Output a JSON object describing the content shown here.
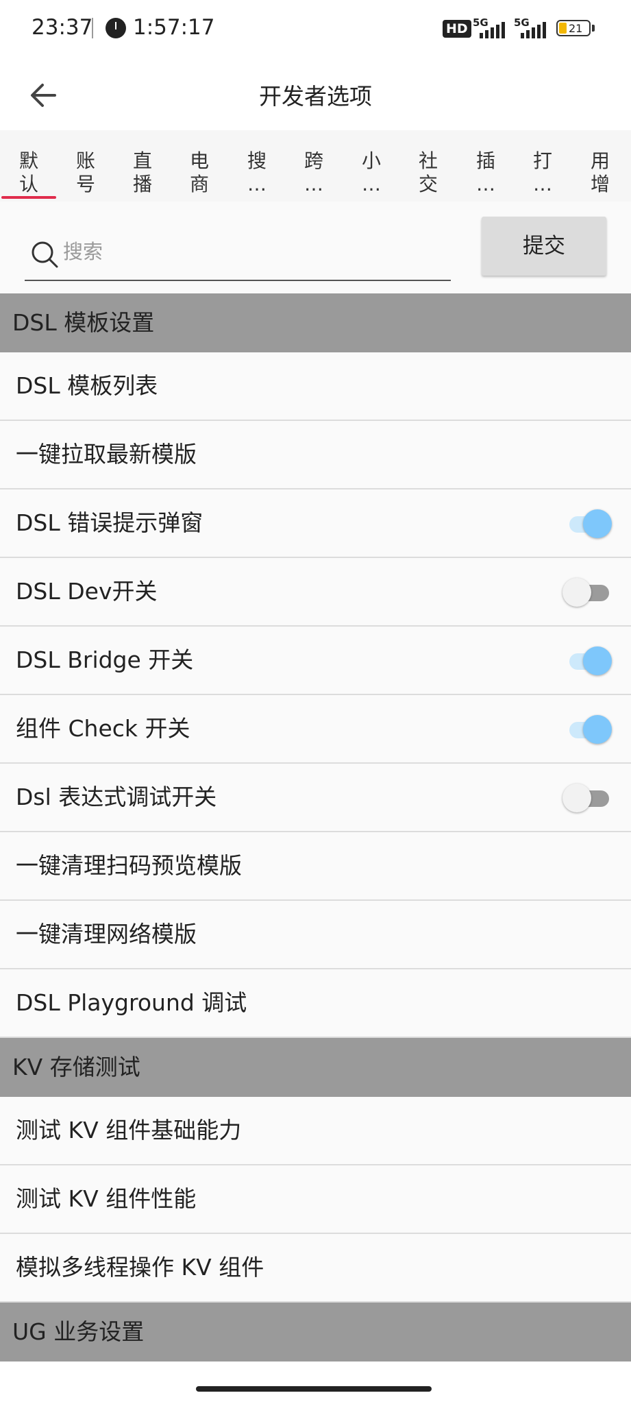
{
  "status_bar": {
    "time": "23:37",
    "timer": "1:57:17",
    "hd_label": "HD",
    "network_1": "5G",
    "network_2": "5G",
    "battery": "21"
  },
  "header": {
    "title": "开发者选项"
  },
  "tabs": [
    {
      "label": "默\n认"
    },
    {
      "label": "账\n号"
    },
    {
      "label": "直\n播"
    },
    {
      "label": "电\n商"
    },
    {
      "label": "搜\n…"
    },
    {
      "label": "跨\n…"
    },
    {
      "label": "小\n…"
    },
    {
      "label": "社\n交"
    },
    {
      "label": "插\n…"
    },
    {
      "label": "打\n…"
    },
    {
      "label": "用\n增"
    }
  ],
  "search": {
    "placeholder": "搜索",
    "value": "",
    "submit_label": "提交"
  },
  "sections": [
    {
      "title": "DSL 模板设置",
      "items": [
        {
          "label": "DSL 模板列表"
        },
        {
          "label": "一键拉取最新模版"
        },
        {
          "label": "DSL 错误提示弹窗",
          "toggle": true
        },
        {
          "label": "DSL Dev开关",
          "toggle": false
        },
        {
          "label": "DSL Bridge 开关",
          "toggle": true
        },
        {
          "label": "组件 Check 开关",
          "toggle": true
        },
        {
          "label": "Dsl 表达式调试开关",
          "toggle": false
        },
        {
          "label": "一键清理扫码预览模版"
        },
        {
          "label": "一键清理网络模版"
        },
        {
          "label": "DSL Playground 调试"
        }
      ]
    },
    {
      "title": "KV 存储测试",
      "items": [
        {
          "label": "测试 KV 组件基础能力"
        },
        {
          "label": "测试 KV 组件性能"
        },
        {
          "label": "模拟多线程操作 KV 组件"
        }
      ]
    },
    {
      "title": "UG 业务设置",
      "items": []
    }
  ],
  "colors": {
    "accent_tab": "#e02c4c",
    "toggle_on": "#7ec7fb",
    "section_bg": "#9a9a9a"
  }
}
